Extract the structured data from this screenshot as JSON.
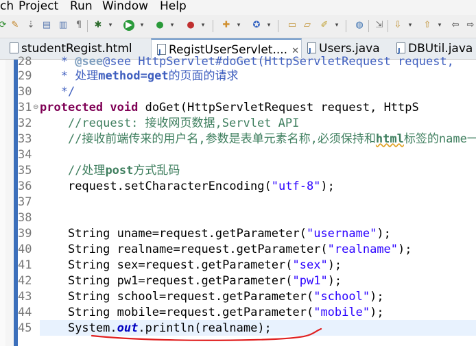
{
  "menu": [
    "ch",
    "Project",
    "Run",
    "Window",
    "Help"
  ],
  "tabs": [
    {
      "label": "studentRegist.html",
      "active": false,
      "kind": "html"
    },
    {
      "label": "RegistUserServlet....",
      "active": true,
      "kind": "java",
      "close": "✕"
    },
    {
      "label": "Users.java",
      "active": false,
      "kind": "java"
    },
    {
      "label": "DBUtil.java",
      "active": false,
      "kind": "java"
    }
  ],
  "editor": {
    "line_numbers": [
      "28",
      "29",
      "30",
      "31",
      "32",
      "33",
      "34",
      "35",
      "36",
      "37",
      "38",
      "39",
      "40",
      "41",
      "42",
      "43",
      "44",
      "45"
    ],
    "lines": {
      "l28": "@see HttpServlet#doGet(HttpServletRequest request,",
      "l29_prefix": "* 处理",
      "l29_tag": "method=get",
      "l29_suffix": "的页面的请求",
      "l30": "*/",
      "l31_kw1": "protected",
      "l31_kw2": "void",
      "l31_rest": "doGet(HttpServletRequest request, HttpS",
      "l32": "//request: 接收网页数据,Servlet API",
      "l33_a": "//接收前端传来的用户名,参数是表单元素名称,必须保持和",
      "l33_b": "html",
      "l33_c": "标签的name一",
      "l35_a": "//处理",
      "l35_b": "post",
      "l35_c": "方式乱码",
      "l36_a": "request.setCharacterEncoding(",
      "l36_str": "\"utf-8\"",
      "l36_b": ");",
      "decl_type": "String",
      "l39_a": "uname=request.getParameter(",
      "l39_str": "\"username\"",
      "l40_a": "realname=request.getParameter(",
      "l40_str": "\"realname\"",
      "l41_a": "sex=request.getParameter(",
      "l41_str": "\"sex\"",
      "l42_a": "pw1=request.getParameter(",
      "l42_str": "\"pw1\"",
      "l43_a": "school=request.getParameter(",
      "l43_str": "\"school\"",
      "l44_a": "mobile=request.getParameter(",
      "l44_str": "\"mobile\"",
      "close": ");",
      "l45_a": "System.",
      "l45_fld": "out",
      "l45_b": ".println(realname);"
    }
  }
}
